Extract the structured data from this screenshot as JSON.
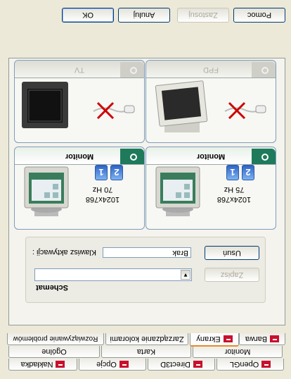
{
  "buttons": {
    "ok": "OK",
    "cancel": "Anuluj",
    "apply": "Zastosuj",
    "help": "Pomoc"
  },
  "tabs": {
    "row1": [
      "Rozwiązywanie problemów",
      "Zarządzanie kolorami",
      "Ekrany",
      "Barwa"
    ],
    "row2": [
      "Ogólne",
      "Karta",
      "Monitor"
    ],
    "row3": [
      "OpenGL",
      "Direct3D",
      "Opcje",
      "Nakładka"
    ]
  },
  "displays": [
    {
      "label": "Monitor",
      "resolution": "1024x768",
      "refresh": "75 Hz",
      "active": true,
      "badge1": "1",
      "badge2": "2"
    },
    {
      "label": "Monitor",
      "resolution": "1024x768",
      "refresh": "70 Hz",
      "active": true,
      "badge1": "1",
      "badge2": "2"
    },
    {
      "label": "FPD",
      "active": false
    },
    {
      "label": "TV",
      "active": false
    }
  ],
  "hotkey": {
    "label": "Klawisz aktywacji :",
    "value": "Brak",
    "delete": "Usuń",
    "save": "Zapisz"
  },
  "scheme": {
    "label": "Schemat",
    "value": ""
  },
  "colors": {
    "accent": "#e68b2c",
    "power_on": "#1e7a5a",
    "disconnect": "#cc0000",
    "badge": "#2d64c8"
  }
}
